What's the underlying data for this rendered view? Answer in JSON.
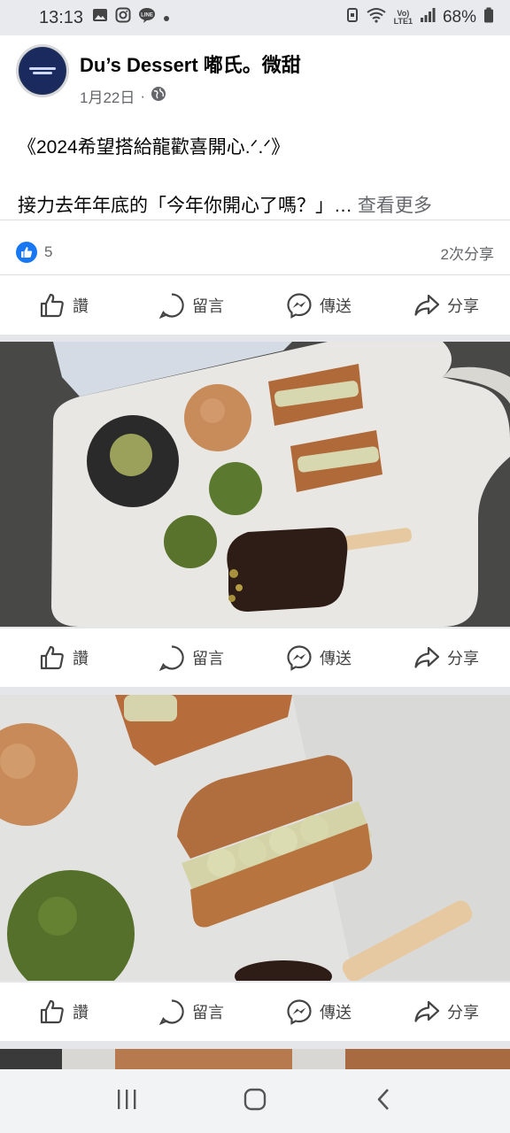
{
  "status_bar": {
    "time": "13:13",
    "battery": "68%",
    "network": "LTE1"
  },
  "post": {
    "page_name": "Du’s Dessert 嘟氏。微甜",
    "date": "1月22日",
    "dot": "·",
    "title": "《2024希望搭給龍歡喜開心.ᐟ.ᐟ》",
    "body": "接力去年年底的「今年你開心了嗎？」…",
    "see_more": "查看更多",
    "reaction_count": "5",
    "shares": "2次分享"
  },
  "actions": {
    "like": "讚",
    "comment": "留言",
    "send": "傳送",
    "share": "分享"
  },
  "icons": [
    "image-icon",
    "instagram-icon",
    "line-icon",
    "wifi-icon",
    "signal-icon",
    "battery-icon",
    "globe-icon",
    "like-icon",
    "comment-icon",
    "messenger-icon",
    "share-icon",
    "recents-icon",
    "home-icon",
    "back-icon"
  ],
  "colors": {
    "accent": "#1877f2",
    "text_secondary": "#65676b"
  }
}
